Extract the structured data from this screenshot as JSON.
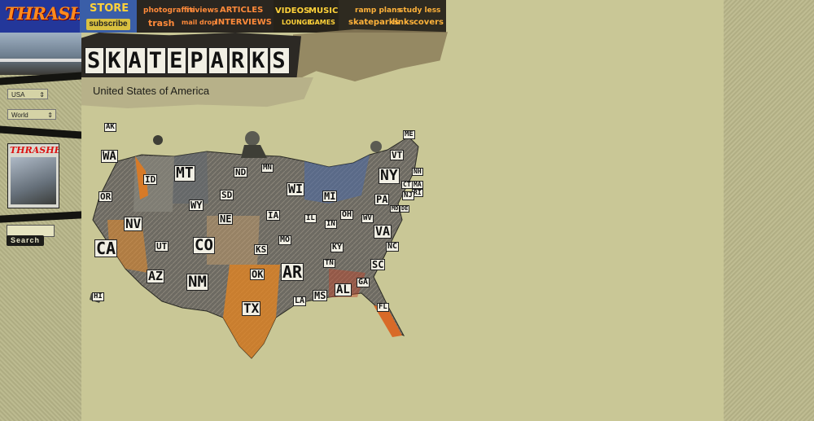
{
  "site": {
    "logo": "THRASHER"
  },
  "header": {
    "store": "STORE",
    "subscribe": "subscribe",
    "nav": [
      {
        "id": "photograffiti",
        "label": "photograffiti"
      },
      {
        "id": "reviews",
        "label": "reviews"
      },
      {
        "id": "articles",
        "label": "ARTICLES"
      },
      {
        "id": "trash",
        "label": "trash"
      },
      {
        "id": "maildrop",
        "label": "mail drop"
      },
      {
        "id": "interviews",
        "label": "INTERVIEWS"
      },
      {
        "id": "videos",
        "label": "VIDEOS"
      },
      {
        "id": "music",
        "label": "MUSIC"
      },
      {
        "id": "lounge",
        "label": "LOUNGE"
      },
      {
        "id": "games",
        "label": "GAMES"
      },
      {
        "id": "rampplans",
        "label": "ramp plans"
      },
      {
        "id": "studyless",
        "label": "study less"
      },
      {
        "id": "skateparks",
        "label": "skateparks"
      },
      {
        "id": "links",
        "label": "links"
      },
      {
        "id": "covers",
        "label": "covers"
      }
    ]
  },
  "title": {
    "letters": [
      "S",
      "K",
      "A",
      "T",
      "E",
      "P",
      "A",
      "R",
      "K",
      "S"
    ],
    "subtitle": "United States of America"
  },
  "sidebar": {
    "country_select": "USA",
    "region_select": "World",
    "magazine_logo": "THRASHER",
    "search_label": "Search"
  },
  "map": {
    "states": [
      {
        "code": "AK"
      },
      {
        "code": "HI"
      },
      {
        "code": "WA"
      },
      {
        "code": "OR"
      },
      {
        "code": "CA"
      },
      {
        "code": "NV"
      },
      {
        "code": "ID"
      },
      {
        "code": "MT"
      },
      {
        "code": "WY"
      },
      {
        "code": "UT"
      },
      {
        "code": "AZ"
      },
      {
        "code": "CO"
      },
      {
        "code": "NM"
      },
      {
        "code": "ND"
      },
      {
        "code": "SD"
      },
      {
        "code": "NE"
      },
      {
        "code": "KS"
      },
      {
        "code": "OK"
      },
      {
        "code": "TX"
      },
      {
        "code": "MN"
      },
      {
        "code": "IA"
      },
      {
        "code": "MO"
      },
      {
        "code": "AR"
      },
      {
        "code": "LA"
      },
      {
        "code": "WI"
      },
      {
        "code": "IL"
      },
      {
        "code": "MI"
      },
      {
        "code": "IN"
      },
      {
        "code": "OH"
      },
      {
        "code": "KY"
      },
      {
        "code": "TN"
      },
      {
        "code": "MS"
      },
      {
        "code": "AL"
      },
      {
        "code": "GA"
      },
      {
        "code": "FL"
      },
      {
        "code": "SC"
      },
      {
        "code": "NC"
      },
      {
        "code": "VA"
      },
      {
        "code": "WV"
      },
      {
        "code": "PA"
      },
      {
        "code": "NY"
      },
      {
        "code": "VT"
      },
      {
        "code": "NH"
      },
      {
        "code": "ME"
      },
      {
        "code": "MA"
      },
      {
        "code": "CT"
      },
      {
        "code": "RI"
      },
      {
        "code": "NJ"
      },
      {
        "code": "DE"
      },
      {
        "code": "MD"
      }
    ]
  },
  "colors": {
    "page_bg": "#c9c796",
    "accent": "#ff8a1c",
    "dark": "#1a1a14"
  }
}
